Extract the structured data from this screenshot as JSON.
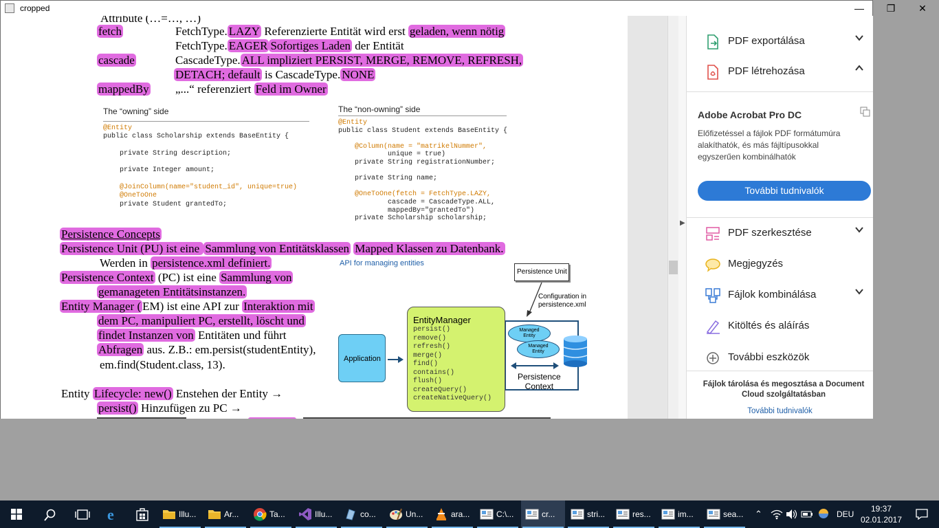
{
  "window": {
    "title": "cropped"
  },
  "doc": {
    "attr_line": "Attribute (…=…, …)",
    "fetch": {
      "key": "fetch",
      "v1a": "FetchType.",
      "v1b": "LAZY",
      "v1c": " Referenzierte Entität wird erst ",
      "v1d": "geladen, wenn nötig",
      "v2a": "FetchType.",
      "v2b": "EAGER",
      "v2c": "Sofortiges Laden",
      "v2d": " der Entität"
    },
    "cascade": {
      "key": "cascade",
      "v1a": "CascadeType.",
      "v1b": "ALL impliziert PERSIST, MERGE, REMOVE, REFRESH,",
      "v2a": "DETACH; default",
      "v2b": " is CascadeType.",
      "v2c": "NONE"
    },
    "mappedby": {
      "key": "mappedBy",
      "va": "„...“ referenziert ",
      "vb": "Feld im Owner"
    },
    "owning": {
      "title": "The “owning” side",
      "lines": [
        "@Entity",
        "public class Scholarship extends BaseEntity {",
        "",
        "    private String description;",
        "",
        "    private Integer amount;",
        "",
        "    @JoinColumn(name=\"student_id\", unique=true)",
        "    @OneToOne",
        "    private Student grantedTo;"
      ]
    },
    "nonowning": {
      "title": "The “non-owning” side",
      "lines": [
        "@Entity",
        "public class Student extends BaseEntity {",
        "",
        "    @Column(name = \"matrikelNummer\",",
        "            unique = true)",
        "    private String registrationNumber;",
        "",
        "    private String name;",
        "",
        "    @OneToOne(fetch = FetchType.LAZY,",
        "            cascade = CascadeType.ALL,",
        "            mappedBy=\"grantedTo\")",
        "    private Scholarship scholarship;"
      ]
    },
    "pc_title": "Persistence Concepts",
    "pu": {
      "a": "Persistence Unit (PU) ist eine ",
      "b": "Sammlung von Entitätsklassen",
      "c": "Mapped Klassen zu Datenbank.",
      "d": "Werden in ",
      "e": "persistence.xml definiert."
    },
    "pctx": {
      "a": "Persistence Context",
      "b": " (PC) ist eine ",
      "c": "Sammlung von",
      "d": "gemanageten Entitätsinstanzen."
    },
    "em": {
      "a": "Entity Manager (",
      "b": "EM) ist eine API zur ",
      "c": "Interaktion mit",
      "d": "dem PC, manipuliert PC, erstellt, löscht und",
      "e": "findet Instanzen von",
      "f": " Entitäten und führt",
      "g": "Abfragen",
      "h": " aus. Z.B.: em.persist(studentEntity),",
      "i": "em.find(Student.class, 13)."
    },
    "lifecycle": {
      "a": "Entity ",
      "b": "Lifecycle: new()",
      "c": " Enstehen der Entity →",
      "d": "persist()",
      "e": " Hinzufügen zu PC →"
    },
    "diagram": {
      "api": "API for managing entities",
      "pu_box": "Persistence Unit",
      "config": "Configuration in\npersistence.xml",
      "em_title": "EntityManager",
      "methods": [
        "persist()",
        "remove()",
        "refresh()",
        "merge()",
        "find()",
        "contains()",
        "flush()",
        "createQuery()",
        "createNativeQuery()"
      ],
      "application": "Application",
      "managed": "Managed\nEntity",
      "pctx": "Persistence\nContext"
    }
  },
  "panel": {
    "tools_top": [
      {
        "label": "PDF exportálása",
        "icon": "export-pdf-icon",
        "chevron": "⌄"
      },
      {
        "label": "PDF létrehozása",
        "icon": "create-pdf-icon",
        "chevron": "⌃"
      }
    ],
    "promo_title": "Adobe Acrobat Pro DC",
    "promo_text": "Előfizetéssel a fájlok PDF formátumúra alakíthatók, és más fájltípusokkal egyszerűen kombinálhatók",
    "promo_button": "További tudnivalók",
    "tools": [
      {
        "label": "PDF szerkesztése",
        "icon": "edit-pdf-icon",
        "chevron": "⌄"
      },
      {
        "label": "Megjegyzés",
        "icon": "comment-icon",
        "chevron": ""
      },
      {
        "label": "Fájlok kombinálása",
        "icon": "combine-files-icon",
        "chevron": "⌄"
      },
      {
        "label": "Kitöltés és aláírás",
        "icon": "fill-sign-icon",
        "chevron": ""
      },
      {
        "label": "További eszközök",
        "icon": "more-tools-icon",
        "chevron": ""
      }
    ],
    "cloud_text": "Fájlok tárolása és megosztása a Document Cloud szolgáltatásban",
    "cloud_link": "További tudnivalók"
  },
  "taskbar": {
    "items": [
      {
        "label": "Illu...",
        "icon": "folder-icon"
      },
      {
        "label": "Ar...",
        "icon": "folder-icon"
      },
      {
        "label": "Ta...",
        "icon": "chrome-icon"
      },
      {
        "label": "Illu...",
        "icon": "visual-studio-icon"
      },
      {
        "label": "co...",
        "icon": "app-icon"
      },
      {
        "label": "Un...",
        "icon": "paint-icon"
      },
      {
        "label": "ara...",
        "icon": "vlc-icon"
      },
      {
        "label": "C:\\...",
        "icon": "image-viewer-icon"
      },
      {
        "label": "cr...",
        "icon": "image-viewer-icon"
      },
      {
        "label": "stri...",
        "icon": "image-viewer-icon"
      },
      {
        "label": "res...",
        "icon": "image-viewer-icon"
      },
      {
        "label": "im...",
        "icon": "image-viewer-icon"
      },
      {
        "label": "sea...",
        "icon": "image-viewer-icon"
      }
    ],
    "lang": "DEU",
    "time": "19:37",
    "date": "02.01.2017"
  }
}
